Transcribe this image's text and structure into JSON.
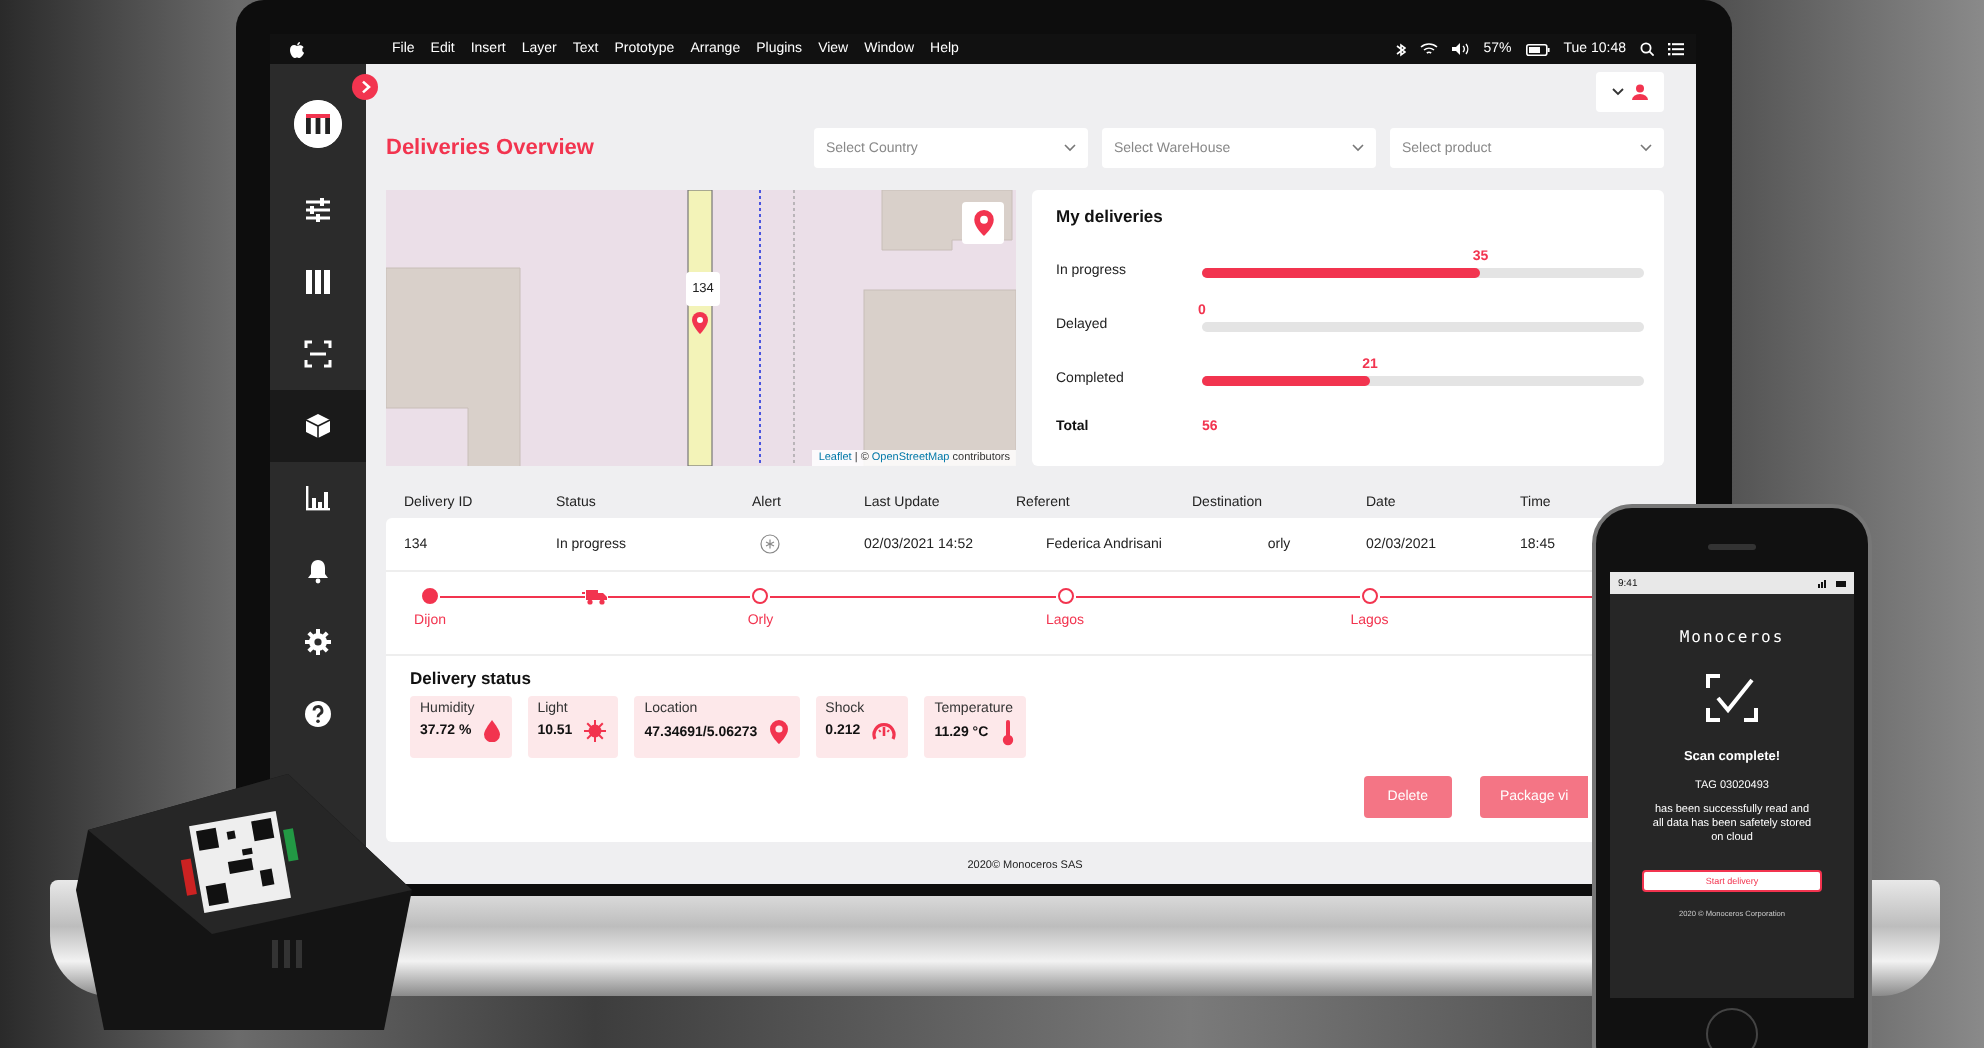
{
  "menubar": {
    "menus": [
      "File",
      "Edit",
      "Insert",
      "Layer",
      "Text",
      "Prototype",
      "Arrange",
      "Plugins",
      "View",
      "Window",
      "Help"
    ],
    "battery": "57%",
    "clock": "Tue 10:48"
  },
  "sidebar": {
    "items": [
      {
        "kind": "sliders",
        "selected": false
      },
      {
        "kind": "columns",
        "selected": false
      },
      {
        "kind": "scan",
        "selected": false
      },
      {
        "kind": "box",
        "selected": true
      },
      {
        "kind": "chart",
        "selected": false
      },
      {
        "kind": "bell",
        "selected": false
      },
      {
        "kind": "gear",
        "selected": false
      },
      {
        "kind": "help",
        "selected": false
      }
    ]
  },
  "header": {
    "title": "Deliveries Overview",
    "filters": [
      {
        "placeholder": "Select Country"
      },
      {
        "placeholder": "Select WareHouse"
      },
      {
        "placeholder": "Select product"
      }
    ]
  },
  "map": {
    "marker_label": "134",
    "attribution": [
      {
        "kind": "link",
        "text": "Leaflet"
      },
      {
        "kind": "text",
        "text": " | © "
      },
      {
        "kind": "link",
        "text": "OpenStreetMap"
      },
      {
        "kind": "text",
        "text": " contributors"
      }
    ]
  },
  "deliveries": {
    "title": "My deliveries",
    "rows": [
      {
        "label": "In progress",
        "value": "35",
        "level": 0.63
      },
      {
        "label": "Delayed",
        "value": "0",
        "level": 0
      },
      {
        "label": "Completed",
        "value": "21",
        "level": 0.38
      }
    ],
    "total_label": "Total",
    "total_value": "56"
  },
  "table": {
    "columns": [
      "Delivery ID",
      "Status",
      "Alert",
      "Last Update",
      "Referent",
      "Destination",
      "Date",
      "Time"
    ],
    "rows": [
      {
        "id": "134",
        "status": "In progress",
        "last_update": "02/03/2021 14:52",
        "referent": "Federica Andrisani",
        "destination": "orly",
        "date": "02/03/2021",
        "time": "18:45"
      }
    ]
  },
  "timeline": {
    "items": [
      {
        "kind": "stop",
        "label": "Dijon",
        "reached": true
      },
      {
        "kind": "vehicle"
      },
      {
        "kind": "stop",
        "label": "Orly",
        "reached": false
      },
      {
        "kind": "stop",
        "label": "Lagos",
        "reached": false
      },
      {
        "kind": "stop",
        "label": "Lagos",
        "reached": false
      }
    ]
  },
  "status": {
    "title": "Delivery status",
    "metrics": [
      {
        "kind": "humidity",
        "label": "Humidity",
        "value": "37.72 %"
      },
      {
        "kind": "light",
        "label": "Light",
        "value": "10.51"
      },
      {
        "kind": "location",
        "label": "Location",
        "value": "47.34691/5.06273"
      },
      {
        "kind": "shock",
        "label": "Shock",
        "value": "0.212"
      },
      {
        "kind": "temperature",
        "label": "Temperature",
        "value": "11.29 °C"
      }
    ]
  },
  "actions": [
    "Delete",
    "Package vi"
  ],
  "footer": "2020© Monoceros SAS",
  "phone": {
    "time": "9:41",
    "brand": "Monoceros",
    "title": "Scan complete!",
    "tag": "TAG 03020493",
    "message": "has been successfully read and all data has been safetely stored on cloud",
    "button": "Start delivery",
    "footer": "2020 © Monoceros Corporation"
  }
}
